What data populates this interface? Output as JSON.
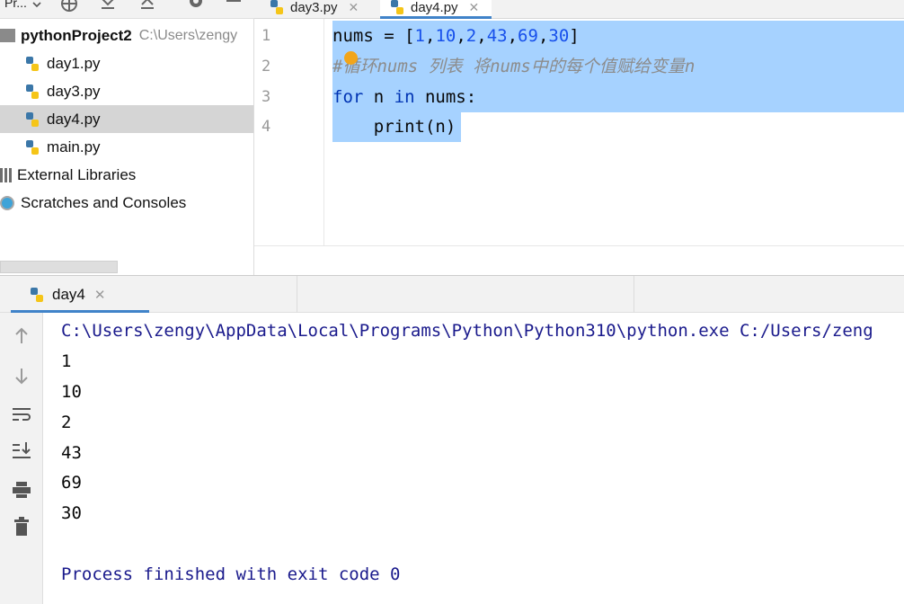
{
  "project_toolbar": {
    "title": "Pr..."
  },
  "editor_tabs": [
    {
      "label": "day3.py"
    },
    {
      "label": "day4.py",
      "active": true
    }
  ],
  "project_tree": {
    "root": {
      "name": "pythonProject2",
      "path": "C:\\Users\\zengy"
    },
    "files": [
      "day1.py",
      "day3.py",
      "day4.py",
      "main.py"
    ],
    "selected_file": "day4.py",
    "external_libraries": "External Libraries",
    "scratches": "Scratches and Consoles"
  },
  "editor": {
    "line_numbers": [
      "1",
      "2",
      "3",
      "4"
    ],
    "line1": {
      "var": "nums",
      "op": " = ",
      "open": "[",
      "n1": "1",
      "n2": "10",
      "n3": "2",
      "n4": "43",
      "n5": "69",
      "n6": "30",
      "comma": ",",
      "close": "]"
    },
    "line2": {
      "comment": "#循环nums 列表 将nums中的每个值赋给变量n"
    },
    "line3": {
      "kw_for": "for",
      "var": " n ",
      "kw_in": "in",
      "rest": " nums:"
    },
    "line4": {
      "code": "    print(n)"
    }
  },
  "run": {
    "tab_label": "day4",
    "command": "C:\\Users\\zengy\\AppData\\Local\\Programs\\Python\\Python310\\python.exe C:/Users/zeng",
    "output": [
      "1",
      "10",
      "2",
      "43",
      "69",
      "30"
    ],
    "exit_message": "Process finished with exit code 0"
  },
  "colors": {
    "keyword": "#0033b3",
    "number": "#1750eb",
    "comment": "#8c8c8c",
    "selection": "#a6d2ff",
    "tab_underline": "#4083c9",
    "console_path": "#1a1a8c"
  }
}
